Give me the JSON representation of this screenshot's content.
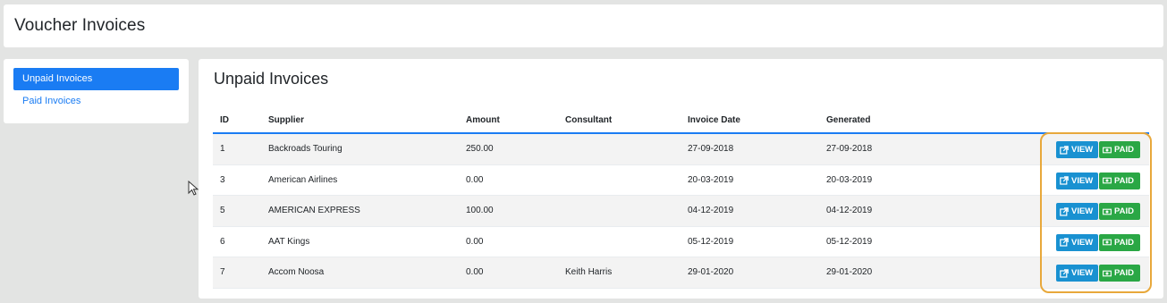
{
  "app": {
    "title": "Voucher Invoices"
  },
  "sidebar": {
    "items": [
      {
        "label": "Unpaid Invoices",
        "active": true
      },
      {
        "label": "Paid Invoices",
        "active": false
      }
    ]
  },
  "main": {
    "title": "Unpaid Invoices",
    "columns": [
      "ID",
      "Supplier",
      "Amount",
      "Consultant",
      "Invoice Date",
      "Generated"
    ],
    "rows": [
      {
        "id": "1",
        "supplier": "Backroads Touring",
        "amount": "250.00",
        "consultant": "",
        "invoice_date": "27-09-2018",
        "generated": "27-09-2018"
      },
      {
        "id": "3",
        "supplier": "American Airlines",
        "amount": "0.00",
        "consultant": "",
        "invoice_date": "20-03-2019",
        "generated": "20-03-2019"
      },
      {
        "id": "5",
        "supplier": "AMERICAN EXPRESS",
        "amount": "100.00",
        "consultant": "",
        "invoice_date": "04-12-2019",
        "generated": "04-12-2019"
      },
      {
        "id": "6",
        "supplier": "AAT Kings",
        "amount": "0.00",
        "consultant": "",
        "invoice_date": "05-12-2019",
        "generated": "05-12-2019"
      },
      {
        "id": "7",
        "supplier": "Accom Noosa",
        "amount": "0.00",
        "consultant": "Keith Harris",
        "invoice_date": "29-01-2020",
        "generated": "29-01-2020"
      }
    ],
    "actions": {
      "view_label": "VIEW",
      "paid_label": "PAID"
    }
  },
  "colors": {
    "primary": "#1a7cf3",
    "view": "#1991d1",
    "paid": "#2aa745",
    "highlight": "#e8a83b"
  },
  "icons": {
    "view": "external-link-icon",
    "paid": "money-icon"
  }
}
